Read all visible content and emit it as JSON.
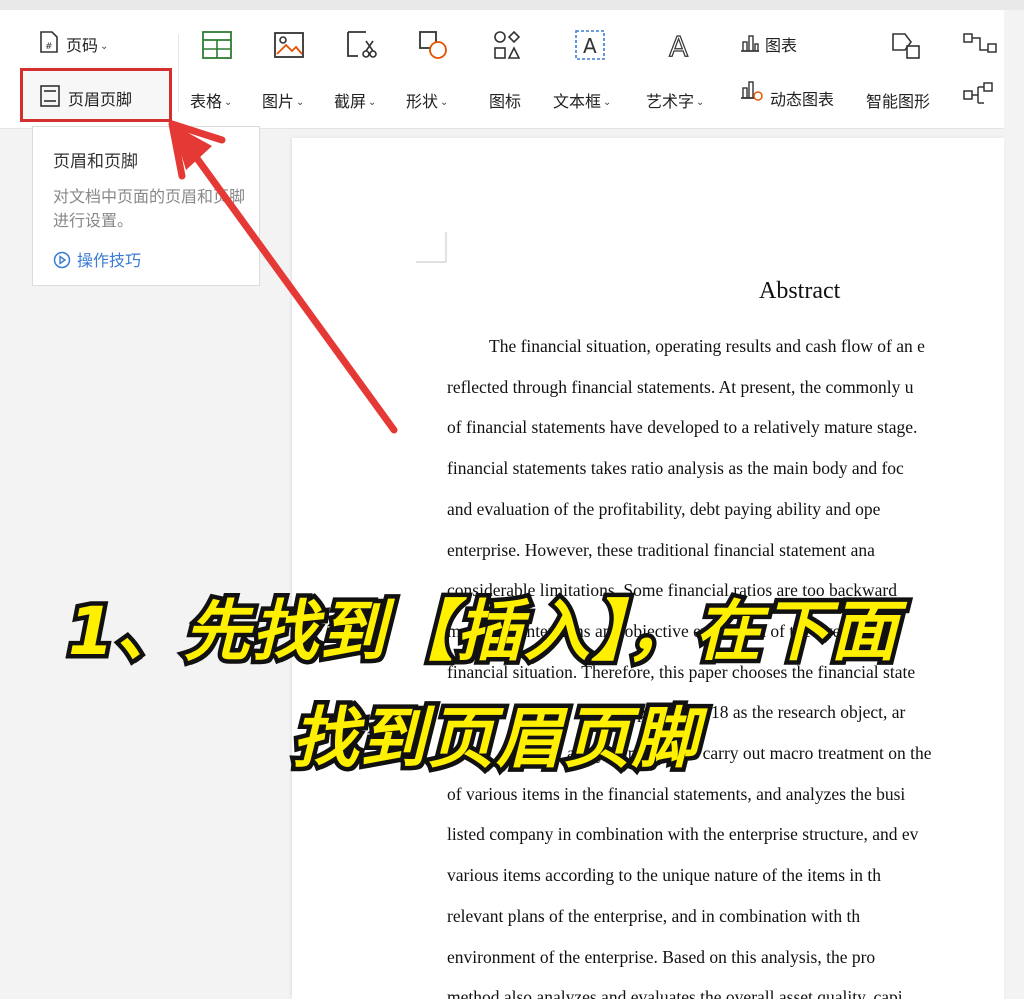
{
  "ribbon": {
    "page_number_label": "页码",
    "header_footer_label": "页眉页脚",
    "items": [
      {
        "label": "表格",
        "dropdown": true,
        "icon": "table-icon"
      },
      {
        "label": "图片",
        "dropdown": true,
        "icon": "picture-icon"
      },
      {
        "label": "截屏",
        "dropdown": true,
        "icon": "screenshot-icon"
      },
      {
        "label": "形状",
        "dropdown": true,
        "icon": "shape-icon"
      },
      {
        "label": "图标",
        "dropdown": false,
        "icon": "icon-library-icon"
      },
      {
        "label": "文本框",
        "dropdown": true,
        "icon": "textbox-icon"
      },
      {
        "label": "艺术字",
        "dropdown": true,
        "icon": "wordart-icon"
      }
    ],
    "chart_label": "图表",
    "dynamic_chart_label": "动态图表",
    "smart_shape_label": "智能图形"
  },
  "tooltip": {
    "title": "页眉和页脚",
    "description": "对文档中页面的页眉和页脚进行设置。",
    "link": "操作技巧"
  },
  "document": {
    "title": "Abstract",
    "lines": [
      "The financial situation, operating results and cash flow of an e",
      "reflected through financial statements. At present, the commonly u",
      "of financial statements have developed to a relatively mature stage.",
      "financial statements takes ratio analysis  as the main body and foc",
      "and evaluation of the profitability, debt paying ability and ope",
      "enterprise. However, these traditional financial statement ana",
      "considerable limitations. Some financial ratios are too backward",
      "managers' intentions and objective evaluation of the overall qual",
      "financial situation. Therefore, this paper chooses the financial state",
      "company in 2018 as the research object, ar",
      "analysis method to carry out macro treatment on the",
      "of various items in the financial statements, and analyzes the busi",
      "listed company in combination with the enterprise structure, and ev",
      "various items according to the unique nature of the items in th",
      "relevant plans of the enterprise, and in combination with th",
      "environment of the enterprise. Based on this analysis, the pro",
      "method also analyzes and evaluates the overall asset quality, capi"
    ]
  },
  "overlay": {
    "caption_line1": "1、先找到【插入】，在下面",
    "caption_line2": "找到页眉页脚",
    "highlight_color": "#d32f2f",
    "caption_color": "#fff000"
  }
}
